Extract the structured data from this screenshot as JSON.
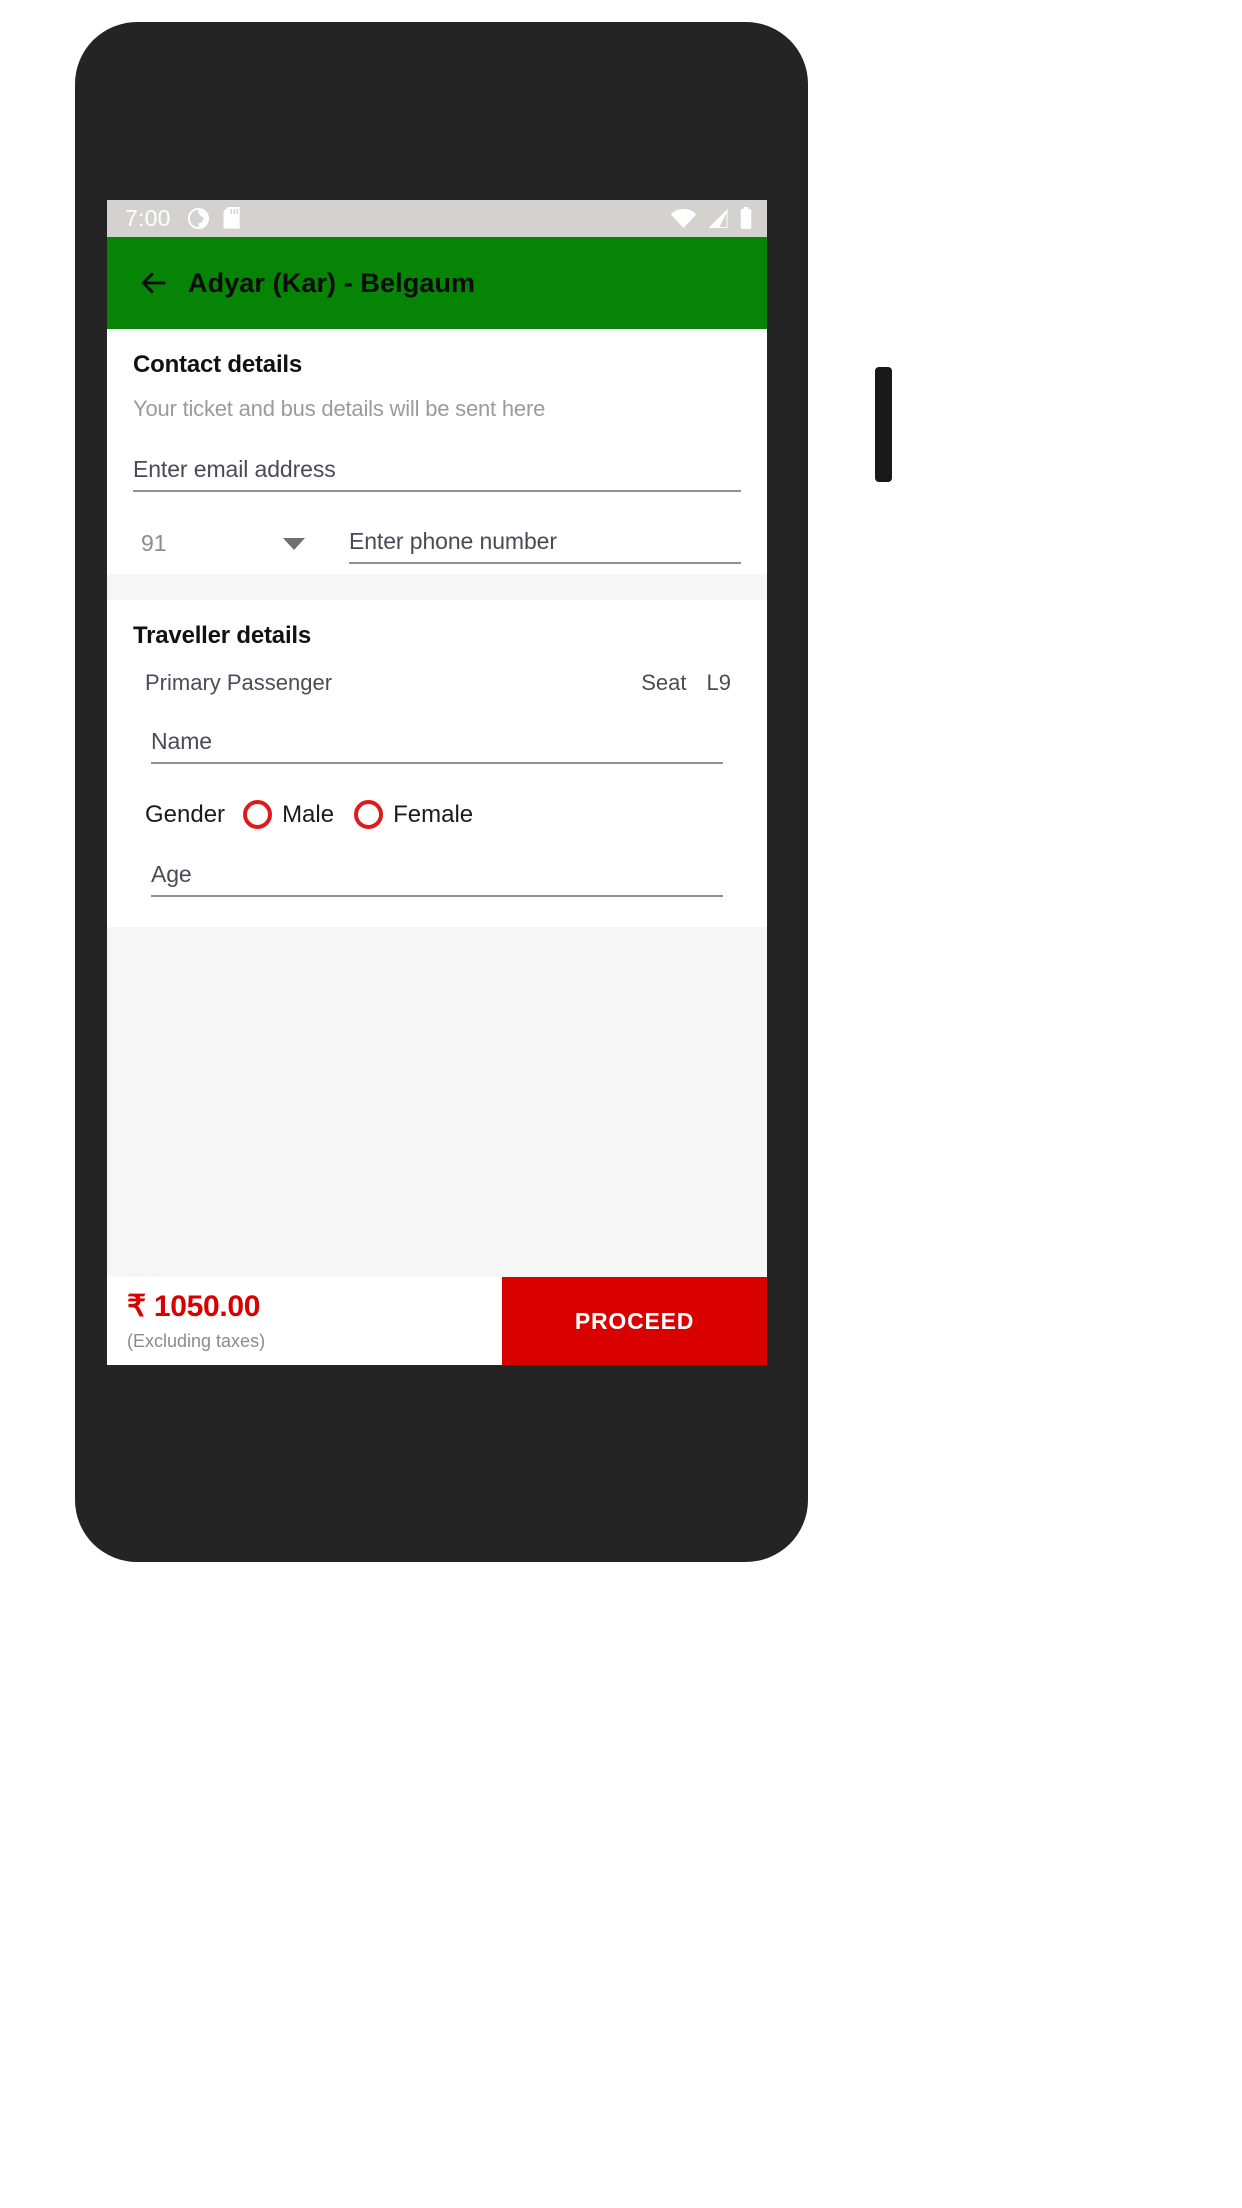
{
  "status_bar": {
    "time": "7:00",
    "left_icons": [
      "do-not-disturb-icon",
      "sd-card-icon"
    ],
    "right_icons": [
      "wifi-icon",
      "cell-signal-icon",
      "battery-icon"
    ]
  },
  "app_bar": {
    "back_icon": "back-arrow-icon",
    "title": "Adyar (Kar) - Belgaum",
    "background_color": "#068406"
  },
  "contact": {
    "title": "Contact details",
    "subtitle": "Your ticket and bus details will be sent here",
    "email": {
      "value": "",
      "placeholder": "Enter email address"
    },
    "country_code": {
      "value": "91",
      "caret_icon": "chevron-down-icon"
    },
    "phone": {
      "value": "",
      "placeholder": "Enter phone number"
    }
  },
  "traveller": {
    "title": "Traveller details",
    "passenger_label": "Primary Passenger",
    "seat_label": "Seat",
    "seat_value": "L9",
    "name": {
      "value": "",
      "placeholder": "Name"
    },
    "gender": {
      "label": "Gender",
      "options": [
        "Male",
        "Female"
      ],
      "selected": "",
      "accent_color": "#e01a1a"
    },
    "age": {
      "value": "",
      "placeholder": "Age"
    }
  },
  "bottom_bar": {
    "price": "₹ 1050.00",
    "price_note": "(Excluding taxes)",
    "price_color": "#d80000",
    "proceed_label": "PROCEED",
    "proceed_color": "#d90000"
  },
  "nav_bar": {
    "back_icon": "nav-back-icon",
    "home_icon": "nav-home-icon",
    "recent_icon": "nav-recent-icon"
  }
}
